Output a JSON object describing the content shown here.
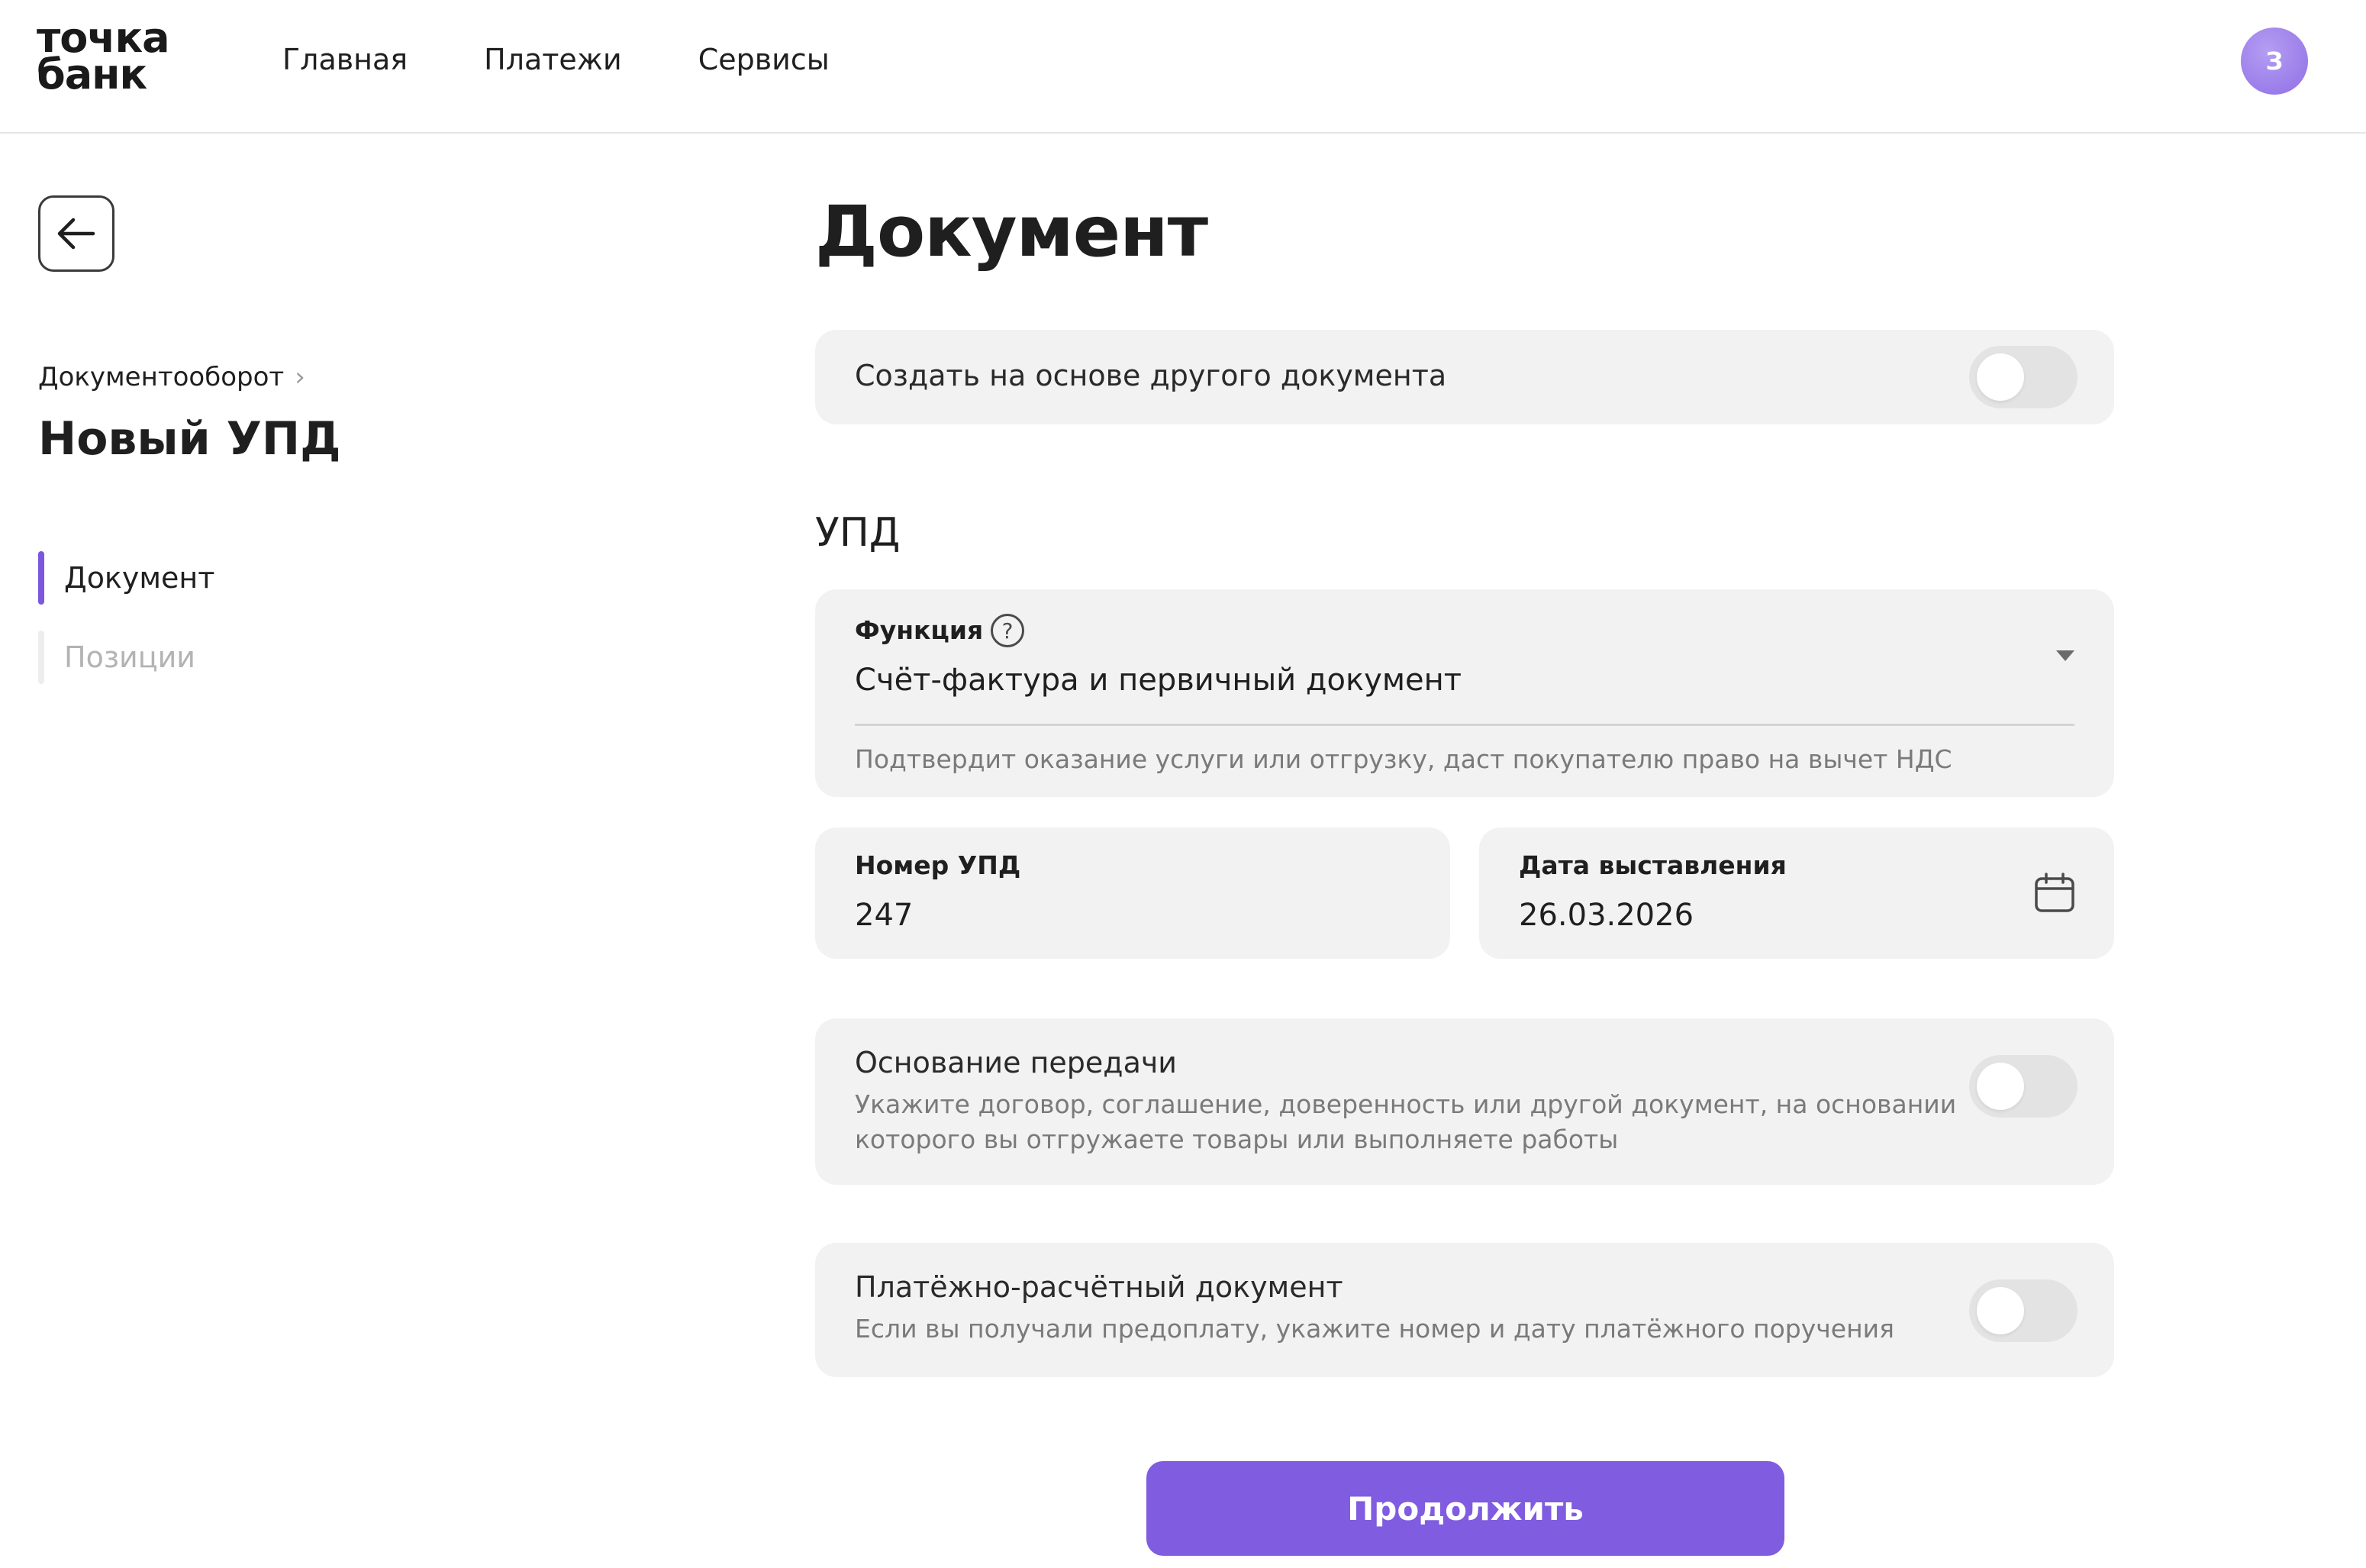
{
  "brand": {
    "line1": "точка",
    "line2": "банк"
  },
  "nav": {
    "items": [
      "Главная",
      "Платежи",
      "Сервисы"
    ]
  },
  "user": {
    "avatar_letter": "З"
  },
  "sidebar": {
    "breadcrumb": "Документооборот",
    "title": "Новый УПД",
    "steps": [
      {
        "label": "Документ",
        "state": "active"
      },
      {
        "label": "Позиции",
        "state": "inactive"
      }
    ]
  },
  "main": {
    "title": "Документ",
    "create_from_other": {
      "label": "Создать на основе другого документа",
      "enabled": false
    },
    "section_title": "УПД",
    "function": {
      "label": "Функция",
      "value": "Счёт-фактура и первичный документ",
      "hint": "Подтвердит оказание услуги или отгрузку, даст покупателю право на вычет НДС"
    },
    "number": {
      "label": "Номер УПД",
      "value": "247"
    },
    "date": {
      "label": "Дата выставления",
      "value": "26.03.2026"
    },
    "transfer_basis": {
      "title": "Основание передачи",
      "desc_line1": "Укажите договор, соглашение, доверенность или другой документ, на основании",
      "desc_line2": "которого вы отгружаете товары или выполняете работы",
      "enabled": false
    },
    "payment_doc": {
      "title": "Платёжно-расчётный документ",
      "desc": "Если вы получали предоплату, укажите номер и дату платёжного поручения",
      "enabled": false
    },
    "continue_label": "Продолжить"
  },
  "colors": {
    "accent": "#7f5ce0",
    "card_bg": "#f2f2f2",
    "toggle_off": "#e3e3e3"
  },
  "icons": {
    "back": "arrow-left-icon",
    "help": "question-circle-icon",
    "calendar": "calendar-icon",
    "dropdown": "caret-down-icon",
    "breadcrumb_sep": "chevron-right-icon"
  }
}
